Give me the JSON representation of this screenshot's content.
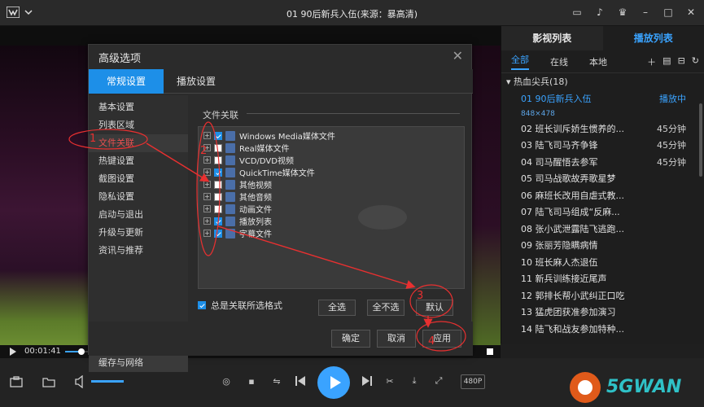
{
  "window": {
    "title": "01 90后新兵入伍(来源：暴高清)"
  },
  "dialog": {
    "title": "高级选项",
    "tabs": [
      {
        "label": "常规设置",
        "active": true
      },
      {
        "label": "播放设置",
        "active": false
      }
    ],
    "sidebar": [
      {
        "label": "基本设置"
      },
      {
        "label": "列表区域"
      },
      {
        "label": "文件关联",
        "active": true
      },
      {
        "label": "热键设置"
      },
      {
        "label": "截图设置"
      },
      {
        "label": "隐私设置"
      },
      {
        "label": "启动与退出"
      },
      {
        "label": "升级与更新"
      },
      {
        "label": "资讯与推荐"
      }
    ],
    "sidebar_bottom": "缓存与网络",
    "section_title": "文件关联",
    "associations": [
      {
        "label": "Windows Media媒体文件",
        "checked": true
      },
      {
        "label": "Real媒体文件",
        "checked": false
      },
      {
        "label": "VCD/DVD视频",
        "checked": false
      },
      {
        "label": "QuickTime媒体文件",
        "checked": true
      },
      {
        "label": "其他视频",
        "checked": false
      },
      {
        "label": "其他音频",
        "checked": false
      },
      {
        "label": "动画文件",
        "checked": false
      },
      {
        "label": "播放列表",
        "checked": true
      },
      {
        "label": "字幕文件",
        "checked": true
      }
    ],
    "always_assoc": {
      "label": "总是关联所选格式",
      "checked": true
    },
    "buttons": {
      "select_all": "全选",
      "select_none": "全不选",
      "default": "默认"
    },
    "footer": {
      "ok": "确定",
      "cancel": "取消",
      "apply": "应用"
    }
  },
  "playlist": {
    "tabs": [
      {
        "label": "影视列表",
        "active": false
      },
      {
        "label": "播放列表",
        "active": true
      }
    ],
    "filters": [
      {
        "label": "全部",
        "active": true
      },
      {
        "label": "在线",
        "active": false
      },
      {
        "label": "本地",
        "active": false
      }
    ],
    "group": "热血尖兵(18)",
    "current_resolution": "848×478",
    "items": [
      {
        "title": "01  90后新兵入伍",
        "duration": "播放中",
        "current": true
      },
      {
        "title": "02  班长训斥娇生惯养的...",
        "duration": "45分钟"
      },
      {
        "title": "03  陆飞司马齐争锋",
        "duration": "45分钟"
      },
      {
        "title": "04  司马醒悟去参军",
        "duration": "45分钟"
      },
      {
        "title": "05  司马战歌故弄歌星梦",
        "duration": ""
      },
      {
        "title": "06  麻班长改用自虐式教...",
        "duration": ""
      },
      {
        "title": "07  陆飞司马组成“反麻...",
        "duration": ""
      },
      {
        "title": "08  张小武泄露陆飞逃跑...",
        "duration": ""
      },
      {
        "title": "09  张丽芳隐瞒病情",
        "duration": ""
      },
      {
        "title": "10  班长麻人杰退伍",
        "duration": ""
      },
      {
        "title": "11  新兵训练接近尾声",
        "duration": ""
      },
      {
        "title": "12  郭排长帮小武纠正口吃",
        "duration": ""
      },
      {
        "title": "13  猛虎团获准参加演习",
        "duration": ""
      },
      {
        "title": "14  陆飞和战友参加特种...",
        "duration": ""
      }
    ]
  },
  "player": {
    "time": "00:01:41",
    "progress_fraction": 0.04,
    "quality": "480P"
  },
  "annotations": [
    "1",
    "2",
    "3",
    "4"
  ],
  "watermark": {
    "text": "5GWAN"
  },
  "colors": {
    "accent": "#1d8fe8",
    "annotation": "#e83030"
  }
}
